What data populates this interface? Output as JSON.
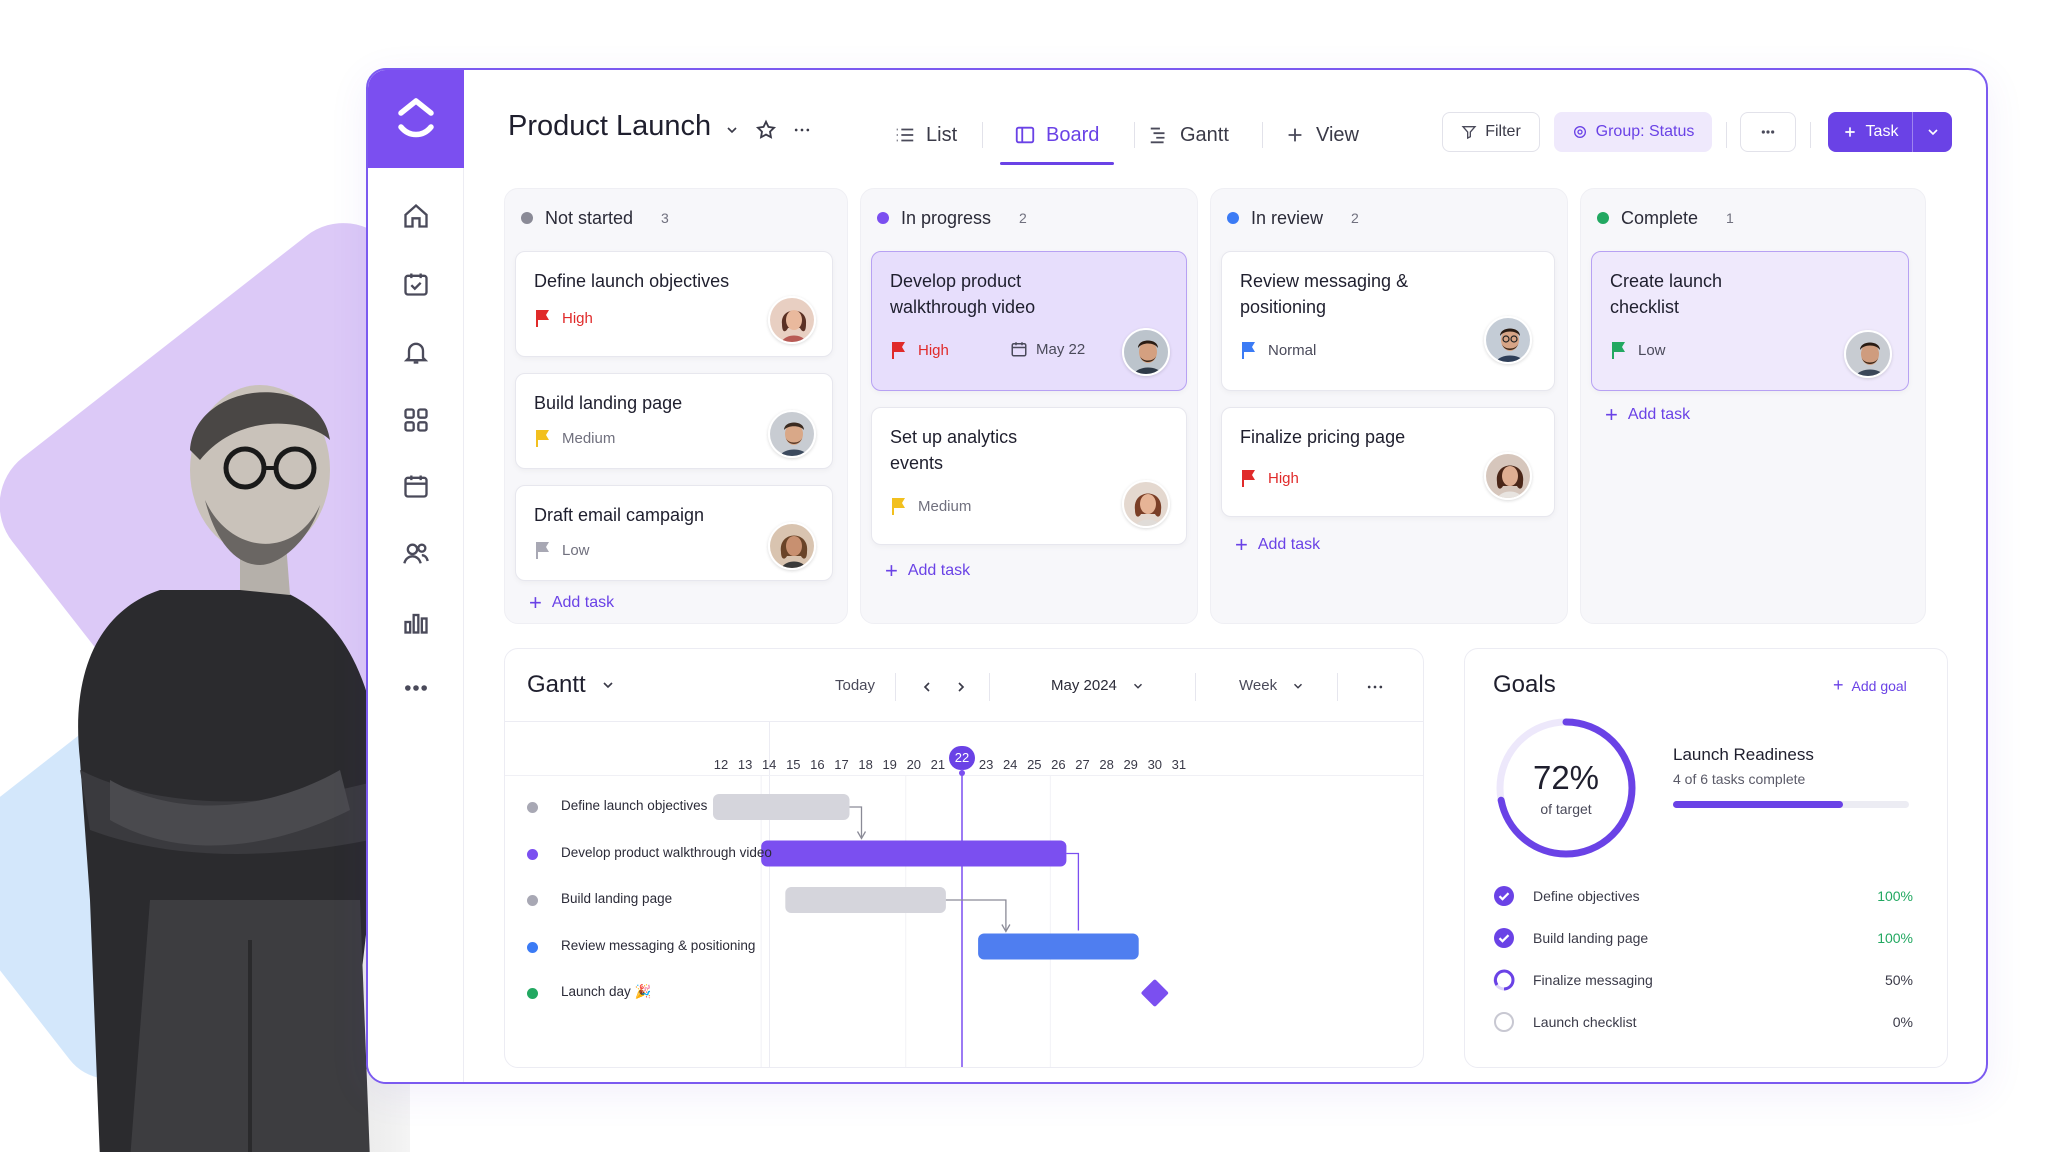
{
  "project": {
    "title": "Product Launch"
  },
  "views": [
    {
      "label": "List",
      "icon": "list-icon"
    },
    {
      "label": "Board",
      "icon": "board-icon",
      "active": true
    },
    {
      "label": "Gantt",
      "icon": "gantt-icon"
    },
    {
      "label": "View",
      "icon": "plus-icon"
    }
  ],
  "toolbar": {
    "filter": "Filter",
    "group": "Group: Status",
    "task": "Task"
  },
  "colors": {
    "accent": "#6a42e6",
    "high": "#e02a2a",
    "medium": "#f2c01e",
    "normal": "#3b7bf5",
    "low": "#22a861",
    "low_gray": "#a8a8b4"
  },
  "board": {
    "columns": [
      {
        "name": "Not started",
        "count": "3",
        "dot": "#8a8a96",
        "cards": [
          {
            "title": "Define launch objectives",
            "priority": "High",
            "pri_color": "#e02a2a",
            "avatar": "woman"
          },
          {
            "title": "Build landing page",
            "priority": "Medium",
            "pri_color": "#f2c01e",
            "avatar": "man"
          },
          {
            "title": "Draft email campaign",
            "priority": "Low",
            "pri_color": "#a8a8b4",
            "avatar": "woman"
          }
        ],
        "add": "Add task"
      },
      {
        "name": "In progress",
        "count": "2",
        "dot": "#7b4ff0",
        "cards": [
          {
            "title": "Develop product walkthrough video",
            "priority": "High",
            "pri_color": "#e02a2a",
            "date": "May 22",
            "avatar": "man"
          },
          {
            "title": "Set up analytics events",
            "priority": "Medium",
            "pri_color": "#f2c01e",
            "avatar": "woman"
          }
        ],
        "add": "Add task"
      },
      {
        "name": "In review",
        "count": "2",
        "dot": "#3b7bf5",
        "cards": [
          {
            "title": "Review messaging & positioning",
            "priority": "Normal",
            "pri_color": "#3b7bf5",
            "avatar": "man"
          },
          {
            "title": "Finalize pricing page",
            "priority": "High",
            "pri_color": "#e02a2a",
            "avatar": "woman"
          }
        ],
        "add": "Add task"
      },
      {
        "name": "Complete",
        "count": "1",
        "dot": "#22a861",
        "cards": [
          {
            "title": "Create launch checklist",
            "priority": "Low",
            "pri_color": "#22a861",
            "avatar": "man"
          }
        ],
        "add": "Add task"
      }
    ]
  },
  "gantt": {
    "title": "Gantt",
    "today": "Today",
    "month": "May 2024",
    "scale": "Week",
    "days": [
      "12",
      "13",
      "14",
      "15",
      "16",
      "17",
      "18",
      "19",
      "20",
      "21",
      "22",
      "23",
      "24",
      "25",
      "26",
      "27",
      "28",
      "29",
      "30",
      "31"
    ],
    "today_day": "22",
    "rows": [
      {
        "label": "Define launch objectives",
        "dot": "#a8a8b4",
        "start": "12",
        "end": "17",
        "color": "#d5d5dc"
      },
      {
        "label": "Develop product walkthrough video",
        "dot": "#7b4ff0",
        "start": "14",
        "end": "26",
        "color": "#7b4ff0"
      },
      {
        "label": "Build landing page",
        "dot": "#a8a8b4",
        "start": "15",
        "end": "21",
        "color": "#d5d5dc"
      },
      {
        "label": "Review messaging & positioning",
        "dot": "#3b7bf5",
        "start": "23",
        "end": "29",
        "color": "#4f7ef0"
      },
      {
        "label": "Launch day 🎉",
        "dot": "#22a861",
        "milestone": "30"
      }
    ]
  },
  "goals": {
    "title": "Goals",
    "add": "Add goal",
    "ring_value": "72%",
    "ring_caption": "of target",
    "ring_fraction": 0.72,
    "readiness_title": "Launch Readiness",
    "readiness_sub": "4 of 6 tasks complete",
    "readiness_fraction": 0.72,
    "items": [
      {
        "label": "Define objectives",
        "value": "100%",
        "state": "done"
      },
      {
        "label": "Build landing page",
        "value": "100%",
        "state": "done"
      },
      {
        "label": "Finalize messaging",
        "value": "50%",
        "state": "half"
      },
      {
        "label": "Launch checklist",
        "value": "0%",
        "state": "empty"
      }
    ]
  }
}
